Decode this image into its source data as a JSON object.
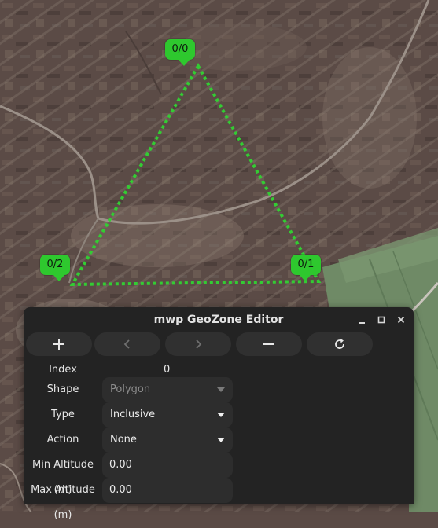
{
  "map": {
    "markers": [
      {
        "label": "0/0"
      },
      {
        "label": "0/1"
      },
      {
        "label": "0/2"
      }
    ],
    "zone_line_color": "#33cc33",
    "marker_color": "#2ec82e"
  },
  "dialog": {
    "title": "mwp GeoZone Editor",
    "window_controls": {
      "minimize_icon": "minimize-icon",
      "maximize_icon": "maximize-icon",
      "close_icon": "close-icon"
    },
    "toolbar": {
      "buttons": [
        {
          "icon": "plus-icon",
          "enabled": true
        },
        {
          "icon": "chevron-left-icon",
          "enabled": false
        },
        {
          "icon": "chevron-right-icon",
          "enabled": false
        },
        {
          "icon": "minus-icon",
          "enabled": true
        },
        {
          "icon": "refresh-icon",
          "enabled": true
        }
      ]
    },
    "form": {
      "index_label": "Index",
      "index_value": "0",
      "shape_label": "Shape",
      "shape_value": "Polygon",
      "type_label": "Type",
      "type_value": "Inclusive",
      "action_label": "Action",
      "action_value": "None",
      "min_alt_label": "Min Altitude (m)",
      "min_alt_value": "0.00",
      "max_alt_label": "Max Altitude (m)",
      "max_alt_value": "0.00"
    },
    "colors": {
      "background": "#232323",
      "widget": "#2d2d2d",
      "button": "#303030"
    }
  }
}
